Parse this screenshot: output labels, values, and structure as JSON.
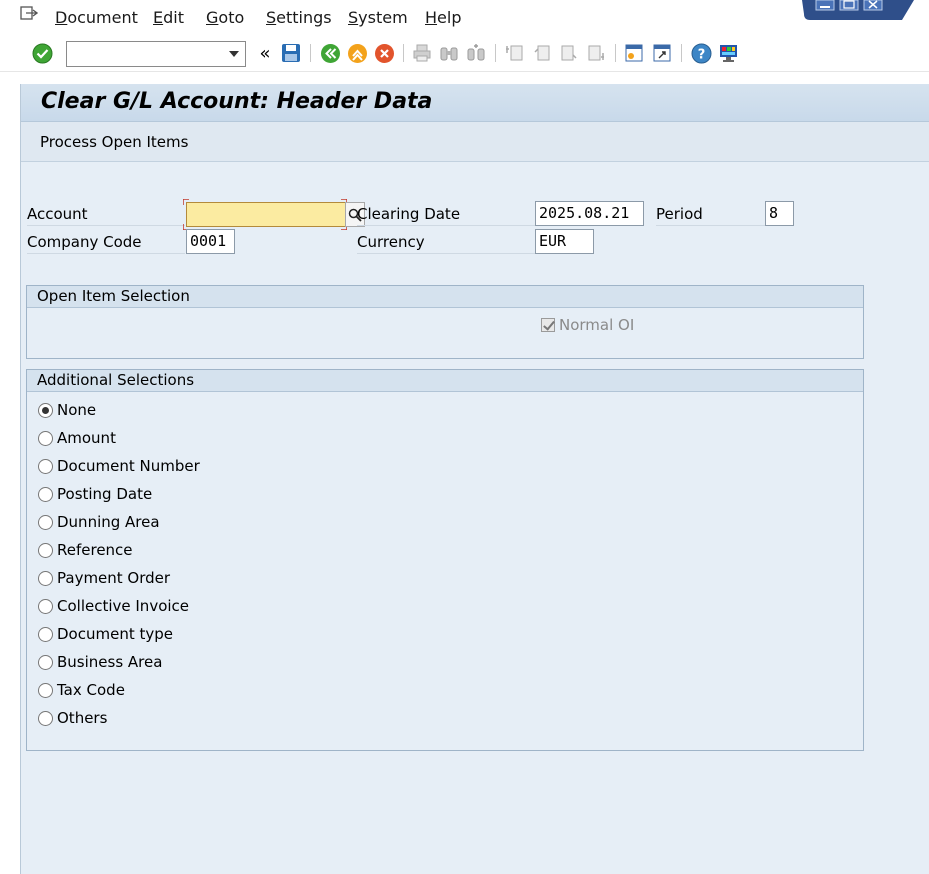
{
  "menu": {
    "items": [
      {
        "label": "Document",
        "u": "D",
        "rest": "ocument"
      },
      {
        "label": "Edit",
        "u": "E",
        "rest": "dit"
      },
      {
        "label": "Goto",
        "u": "G",
        "rest": "oto"
      },
      {
        "label": "Settings",
        "u": "S",
        "rest": "ettings"
      },
      {
        "label": "System",
        "u": "S",
        "rest": "ystem"
      },
      {
        "label": "Help",
        "u": "H",
        "rest": "elp"
      }
    ]
  },
  "toolbar": {
    "command_value": "",
    "back_label": "«"
  },
  "header": {
    "title": "Clear G/L Account: Header Data",
    "subtitle": "Process Open Items"
  },
  "form": {
    "account_label": "Account",
    "account_value": "",
    "clearing_date_label": "Clearing Date",
    "clearing_date_value": "2025.08.21",
    "period_label": "Period",
    "period_value": "8",
    "company_code_label": "Company Code",
    "company_code_value": "0001",
    "currency_label": "Currency",
    "currency_value": "EUR"
  },
  "open_item_selection": {
    "title": "Open Item Selection",
    "normal_oi_label": "Normal OI",
    "normal_oi_checked": true
  },
  "additional_selections": {
    "title": "Additional Selections",
    "options": [
      {
        "label": "None",
        "selected": true
      },
      {
        "label": "Amount",
        "selected": false
      },
      {
        "label": "Document Number",
        "selected": false
      },
      {
        "label": "Posting Date",
        "selected": false
      },
      {
        "label": "Dunning Area",
        "selected": false
      },
      {
        "label": "Reference",
        "selected": false
      },
      {
        "label": "Payment Order",
        "selected": false
      },
      {
        "label": "Collective Invoice",
        "selected": false
      },
      {
        "label": "Document type",
        "selected": false
      },
      {
        "label": "Business Area",
        "selected": false
      },
      {
        "label": "Tax Code",
        "selected": false
      },
      {
        "label": "Others",
        "selected": false
      }
    ]
  },
  "colors": {
    "accent": "#2b6fb3",
    "required_field": "#fbeba1",
    "panel_bg": "#e6eef6"
  }
}
